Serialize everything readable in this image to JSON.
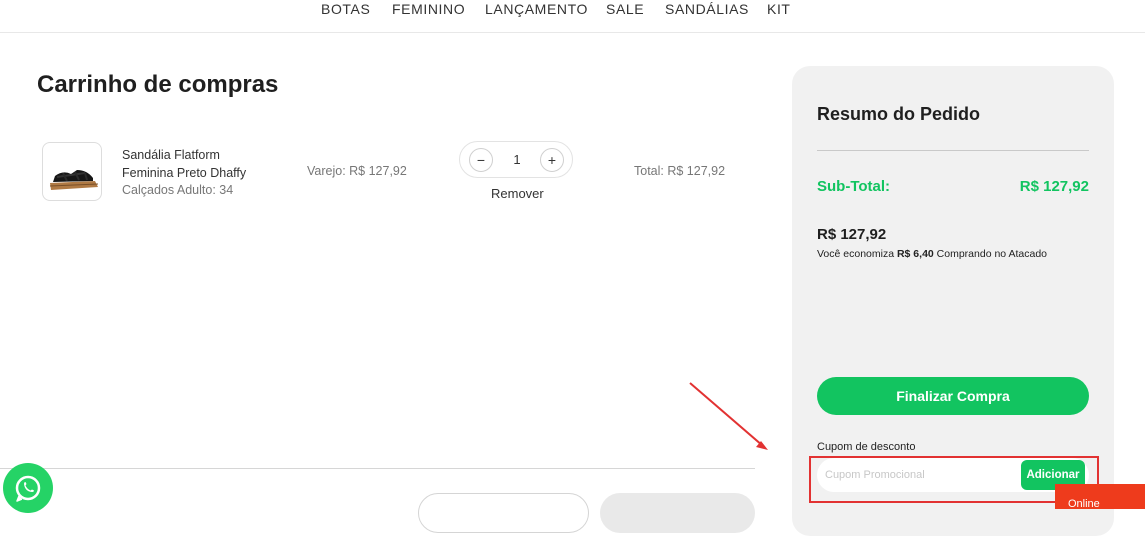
{
  "nav": {
    "items": [
      "BOTAS",
      "FEMININO",
      "LANÇAMENTO",
      "SALE",
      "SANDÁLIAS",
      "KIT"
    ]
  },
  "cart": {
    "title": "Carrinho de compras",
    "item": {
      "name": "Sandália Flatform Feminina Preto Dhaffy",
      "variant": "Calçados Adulto: 34",
      "retail_price": "Varejo: R$ 127,92",
      "quantity": "1",
      "decrease_symbol": "−",
      "increase_symbol": "+",
      "remove_label": "Remover",
      "total": "Total: R$ 127,92"
    }
  },
  "summary": {
    "title": "Resumo do Pedido",
    "subtotal_label": "Sub-Total:",
    "subtotal_value": "R$ 127,92",
    "wholesale_price": "R$ 127,92",
    "savings_prefix": "Você economiza ",
    "savings_amount": "R$ 6,40",
    "savings_suffix": " Comprando no Atacado",
    "checkout_label": "Finalizar Compra",
    "coupon_label": "Cupom de desconto",
    "coupon_placeholder": "Cupom Promocional",
    "coupon_button": "Adicionar"
  },
  "chat_badge": {
    "label": "Online"
  },
  "colors": {
    "accent_green": "#12c460",
    "whatsapp_green": "#25d366",
    "annotation_red": "#e23232",
    "badge_red": "#ee3b1c"
  },
  "icons": {
    "whatsapp": "whatsapp-icon",
    "product": "product-sandal-thumbnail"
  }
}
